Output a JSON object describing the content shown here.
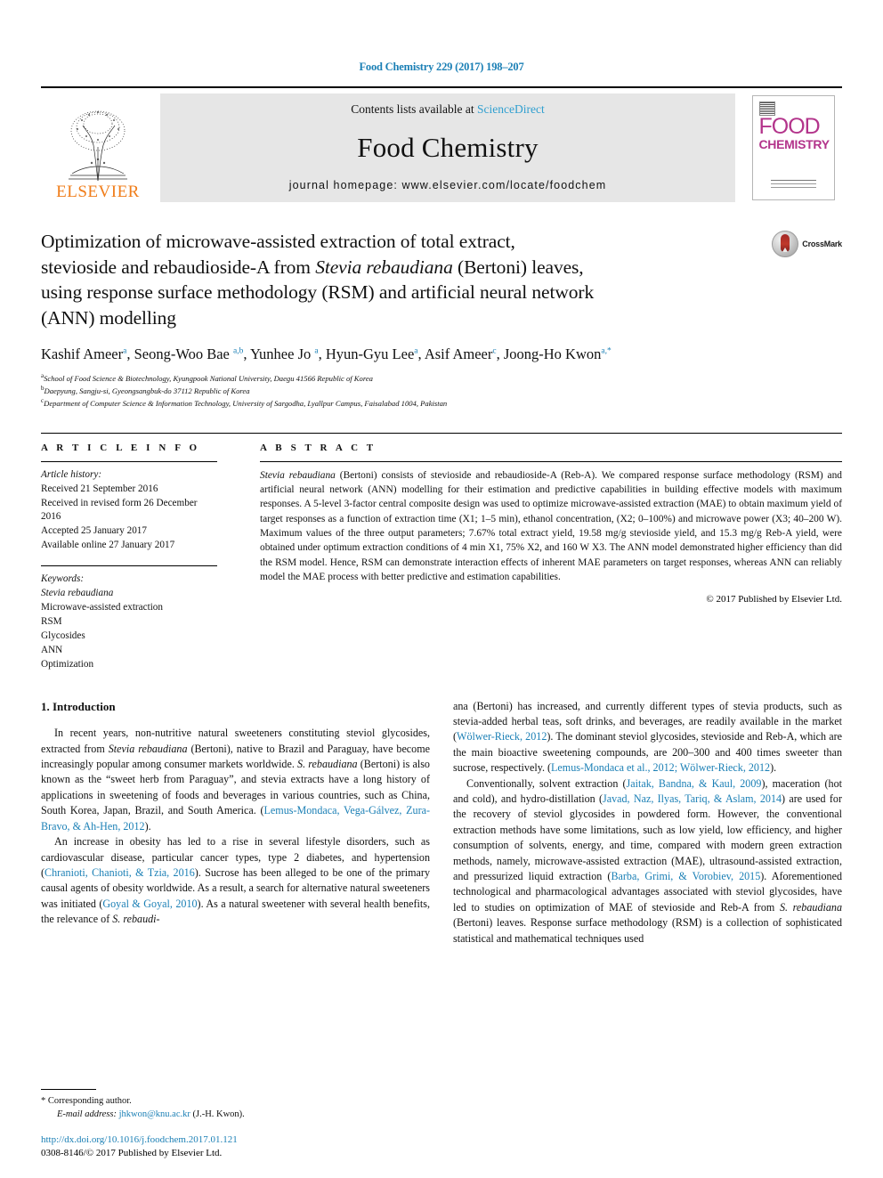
{
  "running_head": "Food Chemistry 229 (2017) 198–207",
  "masthead": {
    "contents_prefix": "Contents lists available at ",
    "sciencedirect": "ScienceDirect",
    "journal_title": "Food Chemistry",
    "homepage": "journal homepage: www.elsevier.com/locate/foodchem",
    "publisher_wordmark": "ELSEVIER",
    "cover": {
      "line1": "FOOD",
      "line2": "CHEMISTRY"
    }
  },
  "article": {
    "title_line1": "Optimization of microwave-assisted extraction of total extract,",
    "title_line2_a": "stevioside and rebaudioside-A from ",
    "title_line2_em": "Stevia rebaudiana",
    "title_line2_b": " (Bertoni) leaves,",
    "title_line3": "using response surface methodology (RSM) and artificial neural network",
    "title_line4": "(ANN) modelling",
    "crossmark_label": "CrossMark"
  },
  "authors": {
    "list": [
      {
        "name": "Kashif Ameer",
        "marks": "a"
      },
      {
        "name": "Seong-Woo Bae",
        "marks": "a,b"
      },
      {
        "name": "Yunhee Jo",
        "marks": "a"
      },
      {
        "name": "Hyun-Gyu Lee",
        "marks": "a"
      },
      {
        "name": "Asif Ameer",
        "marks": "c"
      },
      {
        "name": "Joong-Ho Kwon",
        "marks": "a,*"
      }
    ],
    "affiliations": [
      {
        "mark": "a",
        "text": "School of Food Science & Biotechnology, Kyungpook National University, Daegu 41566 Republic of Korea"
      },
      {
        "mark": "b",
        "text": "Daepyung, Sangju-si, Gyeongsangbuk-do 37112 Republic of Korea"
      },
      {
        "mark": "c",
        "text": "Department of Computer Science & Information Technology, University of Sargodha, Lyallpur Campus, Faisalabad 1004, Pakistan"
      }
    ]
  },
  "article_info": {
    "heading": "A R T I C L E   I N F O",
    "history_label": "Article history:",
    "history": [
      "Received 21 September 2016",
      "Received in revised form 26 December 2016",
      "Accepted 25 January 2017",
      "Available online 27 January 2017"
    ],
    "keywords_label": "Keywords:",
    "keywords": [
      "Stevia rebaudiana",
      "Microwave-assisted extraction",
      "RSM",
      "Glycosides",
      "ANN",
      "Optimization"
    ]
  },
  "abstract": {
    "heading": "A B S T R A C T",
    "text_lead_em": "Stevia rebaudiana",
    "text": " (Bertoni) consists of stevioside and rebaudioside-A (Reb-A). We compared response surface methodology (RSM) and artificial neural network (ANN) modelling for their estimation and predictive capabilities in building effective models with maximum responses. A 5-level 3-factor central composite design was used to optimize microwave-assisted extraction (MAE) to obtain maximum yield of target responses as a function of extraction time (X1; 1–5 min), ethanol concentration, (X2; 0–100%) and microwave power (X3; 40–200 W). Maximum values of the three output parameters; 7.67% total extract yield, 19.58 mg/g stevioside yield, and 15.3 mg/g Reb-A yield, were obtained under optimum extraction conditions of 4 min X1, 75% X2, and 160 W X3. The ANN model demonstrated higher efficiency than did the RSM model. Hence, RSM can demonstrate interaction effects of inherent MAE parameters on target responses, whereas ANN can reliably model the MAE process with better predictive and estimation capabilities.",
    "copyright": "© 2017 Published by Elsevier Ltd."
  },
  "introduction": {
    "heading": "1. Introduction",
    "left_p1_a": "In recent years, non-nutritive natural sweeteners constituting steviol glycosides, extracted from ",
    "left_p1_em1": "Stevia rebaudiana",
    "left_p1_b": " (Bertoni), native to Brazil and Paraguay, have become increasingly popular among consumer markets worldwide. ",
    "left_p1_em2": "S. rebaudiana",
    "left_p1_c": " (Bertoni) is also known as the “sweet herb from Paraguay”, and stevia extracts have a long history of applications in sweetening of foods and beverages in various countries, such as China, South Korea, Japan, Brazil, and South America. (",
    "left_p1_ref": "Lemus-Mondaca, Vega-Gálvez, Zura-Bravo, & Ah-Hen, 2012",
    "left_p1_d": ").",
    "left_p2_a": "An increase in obesity has led to a rise in several lifestyle disorders, such as cardiovascular disease, particular cancer types, type 2 diabetes, and hypertension (",
    "left_p2_ref1": "Chranioti, Chanioti, & Tzia, 2016",
    "left_p2_b": "). Sucrose has been alleged to be one of the primary causal agents of obesity worldwide. As a result, a search for alternative natural sweeteners was initiated (",
    "left_p2_ref2": "Goyal & Goyal, 2010",
    "left_p2_c": "). As a natural sweetener with several health benefits, the relevance of ",
    "left_p2_em": "S. rebaudi-",
    "right_p1_a": "ana (Bertoni) has increased, and currently different types of stevia products, such as stevia-added herbal teas, soft drinks, and beverages, are readily available in the market (",
    "right_p1_ref1": "Wölwer-Rieck, 2012",
    "right_p1_b": "). The dominant steviol glycosides, stevioside and Reb-A, which are the main bioactive sweetening compounds, are 200–300 and 400 times sweeter than sucrose, respectively. (",
    "right_p1_ref2": "Lemus-Mondaca et al., 2012; Wölwer-Rieck, 2012",
    "right_p1_c": ").",
    "right_p2_a": "Conventionally, solvent extraction (",
    "right_p2_ref1": "Jaitak, Bandna, & Kaul, 2009",
    "right_p2_b": "), maceration (hot and cold), and hydro-distillation (",
    "right_p2_ref2": "Javad, Naz, Ilyas, Tariq, & Aslam, 2014",
    "right_p2_c": ") are used for the recovery of steviol glycosides in powdered form. However, the conventional extraction methods have some limitations, such as low yield, low efficiency, and higher consumption of solvents, energy, and time, compared with modern green extraction methods, namely, microwave-assisted extraction (MAE), ultrasound-assisted extraction, and pressurized liquid extraction (",
    "right_p2_ref3": "Barba, Grimi, & Vorobiev, 2015",
    "right_p2_d": "). Aforementioned technological and pharmacological advantages associated with steviol glycosides, have led to studies on optimization of MAE of stevioside and Reb-A from ",
    "right_p2_em": "S. rebaudiana",
    "right_p2_e": " (Bertoni) leaves. Response surface methodology (RSM) is a collection of sophisticated statistical and mathematical techniques used"
  },
  "footnote": {
    "corresponding_mark": "*",
    "corresponding_text": " Corresponding author.",
    "email_label": "E-mail address:",
    "email": "jhkwon@knu.ac.kr",
    "email_suffix": " (J.-H. Kwon)."
  },
  "publication_footer": {
    "doi": "http://dx.doi.org/10.1016/j.foodchem.2017.01.121",
    "issn_line": "0308-8146/© 2017 Published by Elsevier Ltd."
  },
  "colors": {
    "link": "#1a7fb5",
    "sciencedirect": "#2f9fd0",
    "elsevier_orange": "#f07d1a",
    "cover_magenta": "#b3348b",
    "masthead_bg": "#e6e6e6"
  }
}
